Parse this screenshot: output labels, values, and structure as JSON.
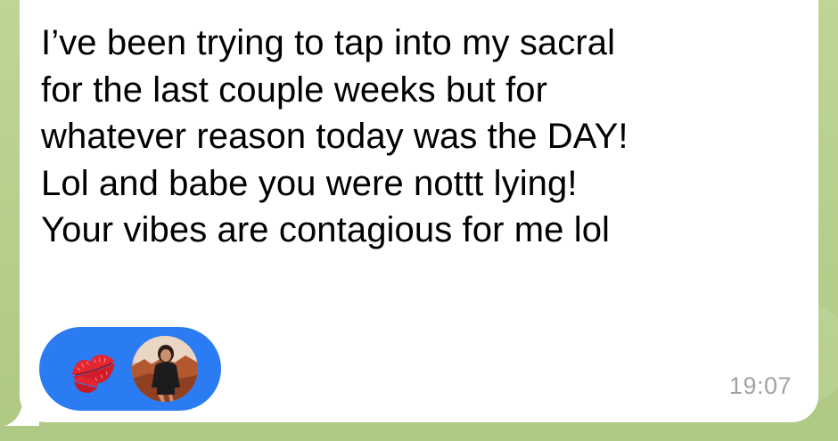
{
  "message": {
    "text": "I’ve been trying to tap into my sacral\nfor the last couple weeks but for\nwhatever reason today was the DAY!\nLol and babe you were nottt lying!\nYour vibes are contagious for me lol",
    "timestamp": "19:07"
  },
  "reaction": {
    "emoji_icon": "kiss-mark-icon",
    "reactor_avatar": "user-avatar",
    "accent_color": "#2b7cf3",
    "emoji_color": "#e3262f"
  },
  "theme": {
    "bubble_color": "#ffffff",
    "wallpaper_color": "#b7cf8c",
    "timestamp_color": "#a0a3a6"
  }
}
